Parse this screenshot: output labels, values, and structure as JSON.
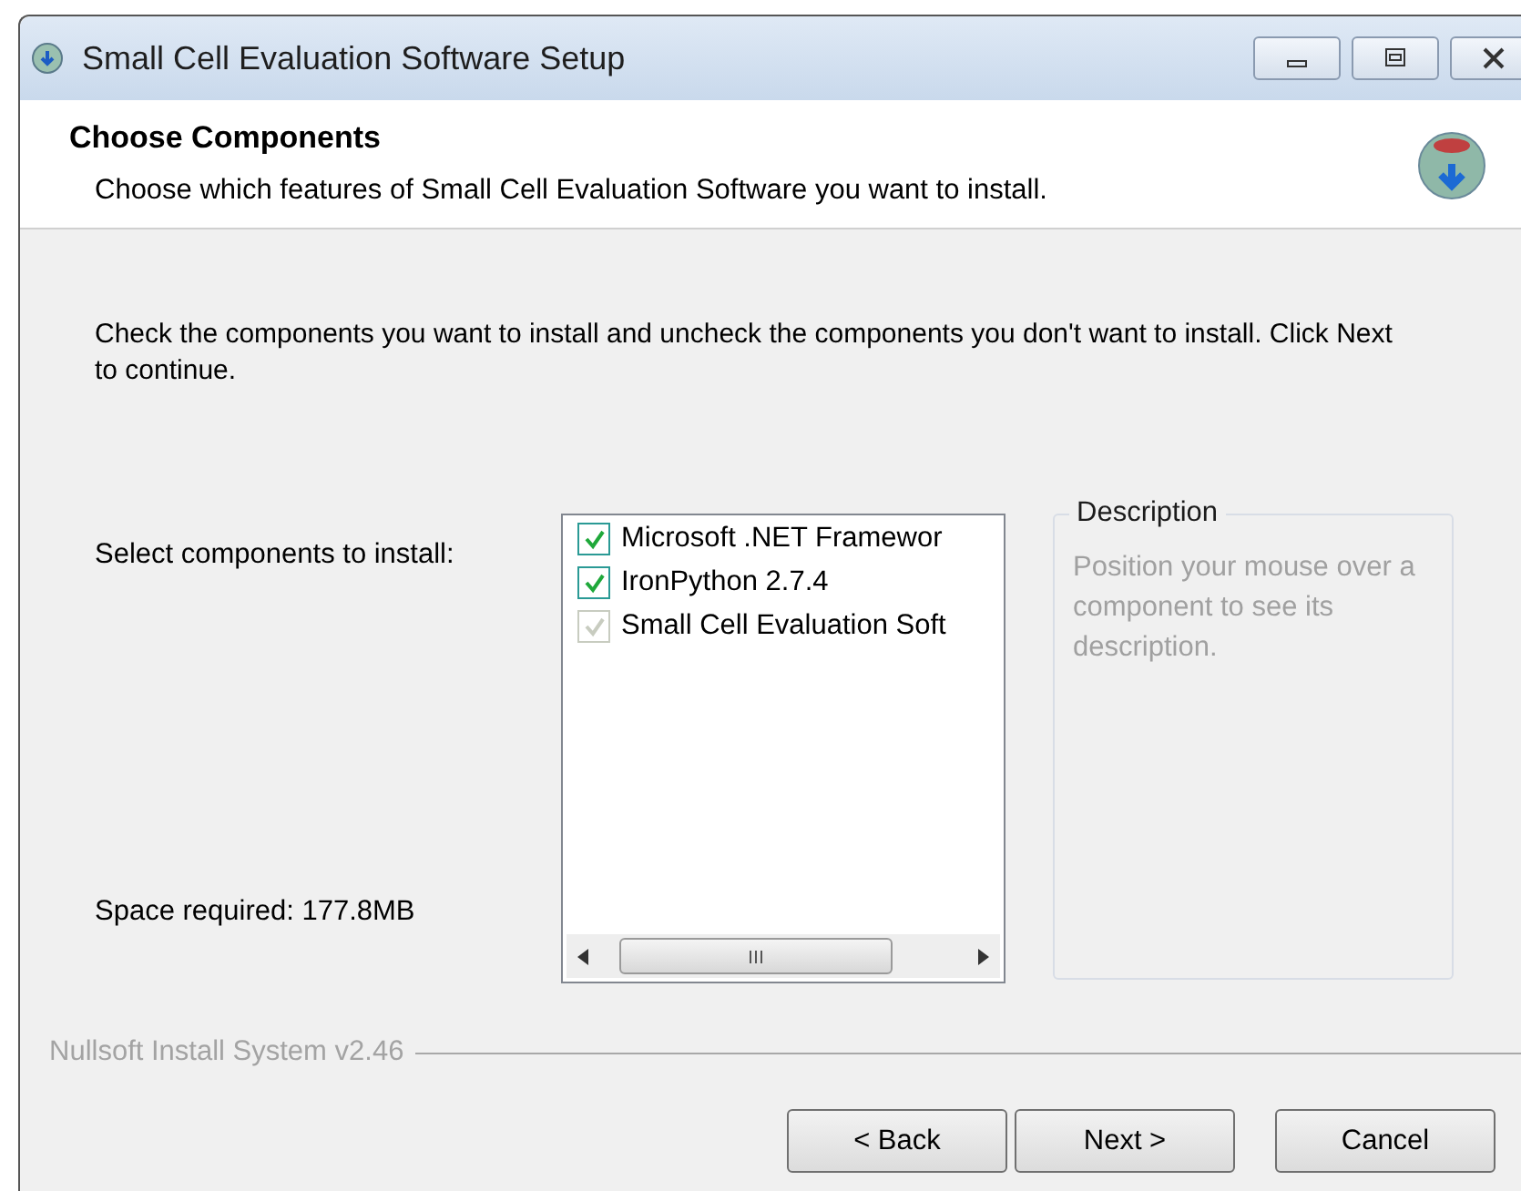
{
  "window": {
    "title": "Small Cell Evaluation Software Setup"
  },
  "header": {
    "title": "Choose Components",
    "subtitle": "Choose which features of Small Cell Evaluation Software you want to install."
  },
  "intro": "Check the components you want to install and uncheck the components you don't want to install. Click Next to continue.",
  "select_label": "Select components to install:",
  "components": [
    {
      "label": "Microsoft .NET Framewor",
      "checked": true,
      "disabled": false
    },
    {
      "label": "IronPython 2.7.4",
      "checked": true,
      "disabled": false
    },
    {
      "label": "Small Cell Evaluation Soft",
      "checked": true,
      "disabled": true
    }
  ],
  "description": {
    "legend": "Description",
    "text": "Position your mouse over a component to see its description."
  },
  "space_required": "Space required: 177.8MB",
  "branding": "Nullsoft Install System v2.46",
  "buttons": [
    "< Back",
    "Next >",
    "Cancel"
  ]
}
